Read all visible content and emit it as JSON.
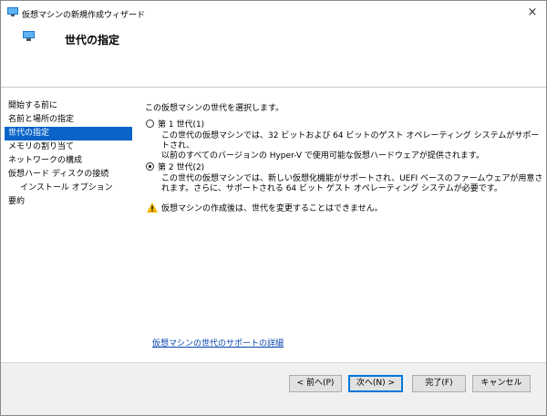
{
  "window": {
    "title": "仮想マシンの新規作成ウィザード",
    "close_glyph": "×"
  },
  "header": {
    "title": "世代の指定"
  },
  "nav": {
    "items": [
      {
        "label": "開始する前に"
      },
      {
        "label": "名前と場所の指定"
      },
      {
        "label": "世代の指定",
        "selected": true
      },
      {
        "label": "メモリの割り当て"
      },
      {
        "label": "ネットワークの構成"
      },
      {
        "label": "仮想ハード ディスクの接続"
      },
      {
        "label": "インストール オプション",
        "indent": true
      },
      {
        "label": "要約"
      }
    ]
  },
  "content": {
    "lead": "この仮想マシンの世代を選択します。",
    "options": [
      {
        "label": "第 1 世代(1)",
        "checked": false,
        "description_lines": [
          "この世代の仮想マシンでは、32 ビットおよび 64 ビットのゲスト オペレーティング システムがサポートされ、",
          "以前のすべてのバージョンの Hyper-V で使用可能な仮想ハードウェアが提供されます。"
        ]
      },
      {
        "label": "第 2 世代(2)",
        "checked": true,
        "description_lines": [
          "この世代の仮想マシンでは、新しい仮想化機能がサポートされ、UEFI ベースのファームウェアが用意さ",
          "れます。さらに、サポートされる 64 ビット ゲスト オペレーティング システムが必要です。"
        ]
      }
    ],
    "warning": "仮想マシンの作成後は、世代を変更することはできません。",
    "help_link": "仮想マシンの世代のサポートの詳細"
  },
  "footer": {
    "back_label": "< 前へ(P)",
    "next_label": "次へ(N) >",
    "finish_label": "完了(F)",
    "cancel_label": "キャンセル"
  },
  "colors": {
    "accent": "#0078d7",
    "selected_bg": "#0a64c8",
    "link": "#0645ad",
    "warning": "#f2b600"
  },
  "icons": {
    "app": "hyperv-vm-icon",
    "header": "hyperv-vm-icon",
    "warning": "warning-icon",
    "close": "close-icon"
  }
}
